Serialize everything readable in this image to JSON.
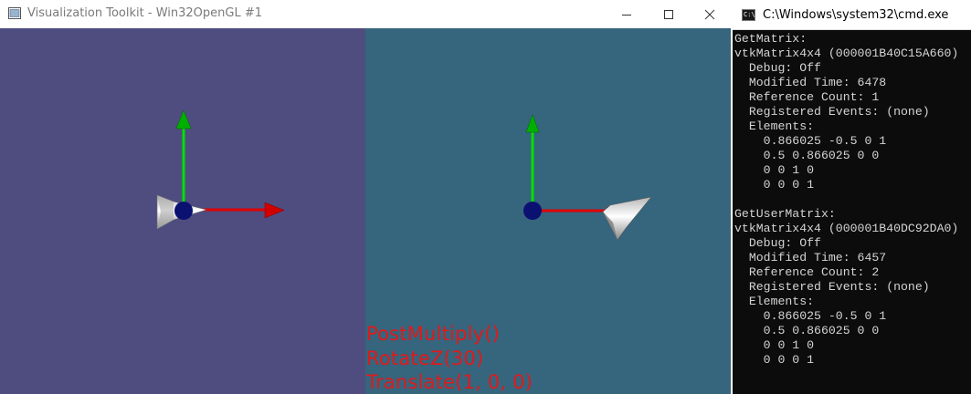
{
  "vtk_window": {
    "title": "Visualization Toolkit - Win32OpenGL #1",
    "left_viewport_color": "#4f4d7f",
    "right_viewport_color": "#36657e",
    "transform_labels": [
      "PostMultiply()",
      "RotateZ(30)",
      "Translate(1, 0, 0)"
    ],
    "axis_colors": {
      "x": "#ff0000",
      "y": "#00e000",
      "origin": "#0b1170"
    }
  },
  "cmd_window": {
    "title": "C:\\Windows\\system32\\cmd.exe",
    "icon_text": "C:\\",
    "output_lines": [
      "GetMatrix:",
      "vtkMatrix4x4 (000001B40C15A660)",
      "  Debug: Off",
      "  Modified Time: 6478",
      "  Reference Count: 1",
      "  Registered Events: (none)",
      "  Elements:",
      "    0.866025 -0.5 0 1",
      "    0.5 0.866025 0 0",
      "    0 0 1 0",
      "    0 0 0 1",
      "",
      "GetUserMatrix:",
      "vtkMatrix4x4 (000001B40DC92DA0)",
      "  Debug: Off",
      "  Modified Time: 6457",
      "  Reference Count: 2",
      "  Registered Events: (none)",
      "  Elements:",
      "    0.866025 -0.5 0 1",
      "    0.5 0.866025 0 0",
      "    0 0 1 0",
      "    0 0 0 1"
    ]
  }
}
